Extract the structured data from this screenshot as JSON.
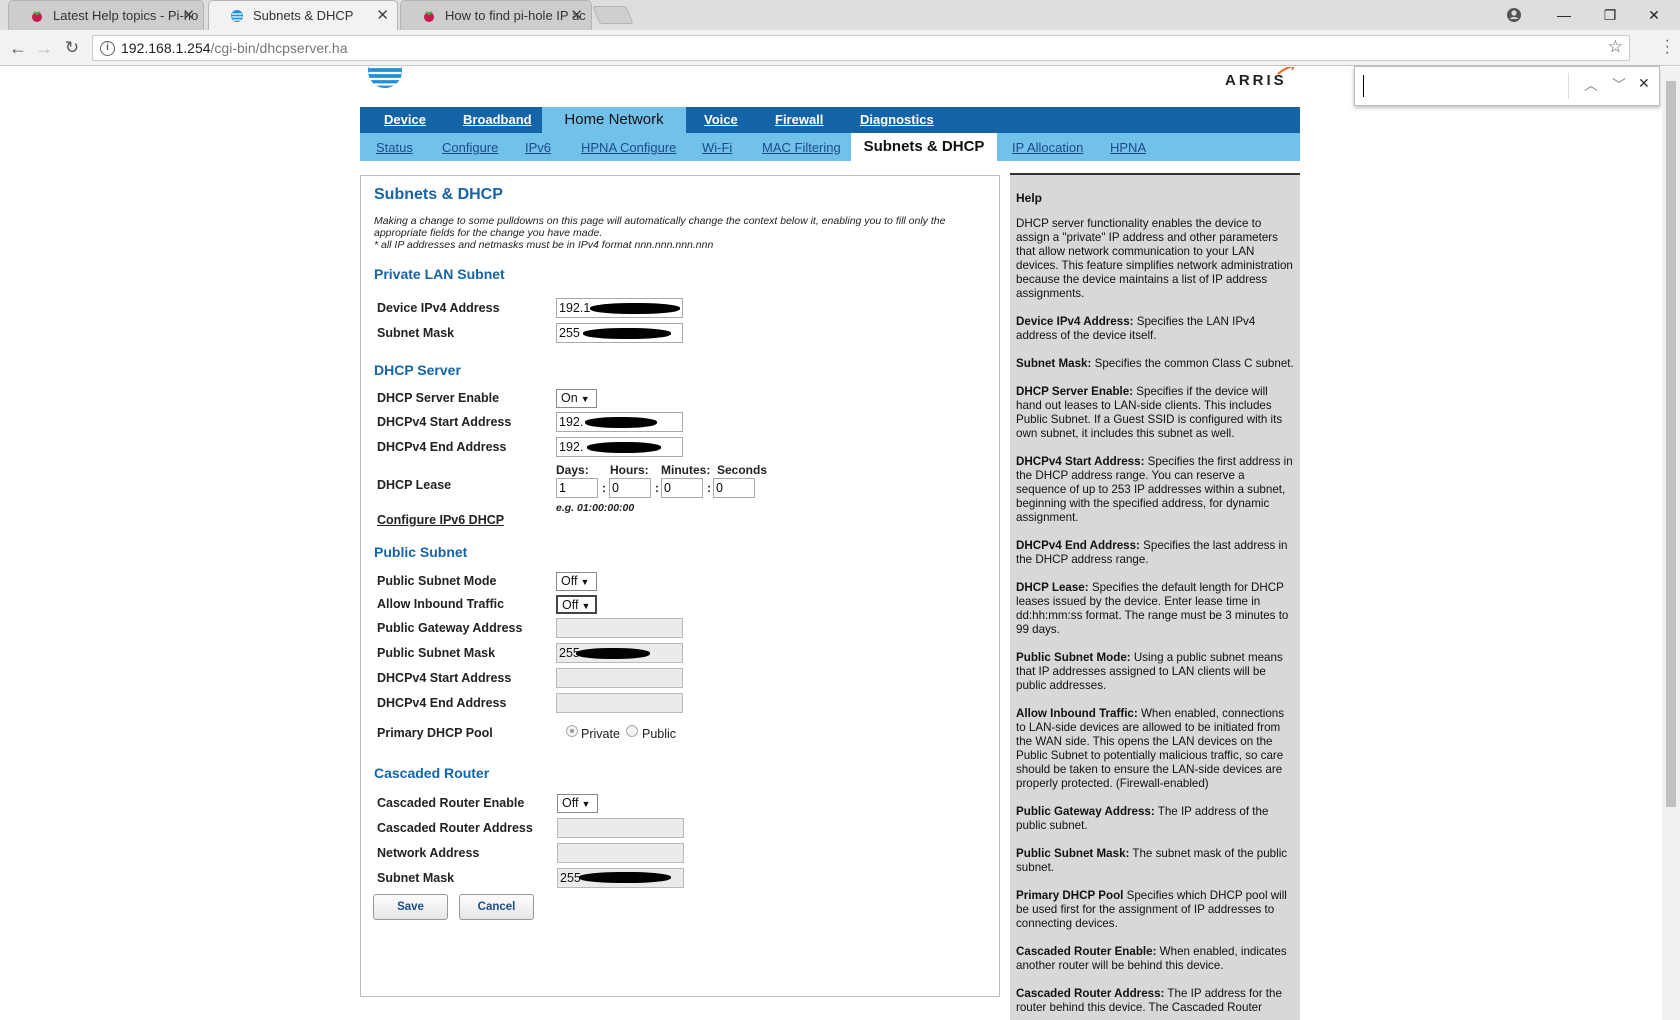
{
  "browser": {
    "tabs": [
      {
        "title": "Latest Help topics - Pi-ho",
        "active": false
      },
      {
        "title": "Subnets & DHCP",
        "active": true
      },
      {
        "title": "How to find pi-hole IP ac",
        "active": false
      }
    ],
    "url_host": "192.168.1.254",
    "url_path": "/cgi-bin/dhcpserver.ha"
  },
  "header": {
    "arris_logo": "ARRIS"
  },
  "mainnav": {
    "items": [
      "Device",
      "Broadband",
      "Home Network",
      "Voice",
      "Firewall",
      "Diagnostics"
    ],
    "active": "Home Network"
  },
  "subnav": {
    "items": [
      "Status",
      "Configure",
      "IPv6",
      "HPNA Configure",
      "Wi-Fi",
      "MAC Filtering",
      "Subnets & DHCP",
      "IP Allocation",
      "HPNA"
    ],
    "active": "Subnets & DHCP"
  },
  "main": {
    "title": "Subnets & DHCP",
    "intro1": "Making a change to some pulldowns on this page will automatically change the context below it, enabling you to fill only the appropriate fields for the change you have made.",
    "intro2": "* all IP addresses and netmasks must be in IPv4 format nnn.nnn.nnn.nnn",
    "private_lan": {
      "heading": "Private LAN Subnet",
      "device_ip_label": "Device IPv4 Address",
      "device_ip_value": "192.1",
      "subnet_mask_label": "Subnet Mask",
      "subnet_mask_value": "255"
    },
    "dhcp_server": {
      "heading": "DHCP Server",
      "enable_label": "DHCP Server Enable",
      "enable_value": "On",
      "start_label": "DHCPv4 Start Address",
      "start_value": "192.",
      "end_label": "DHCPv4 End Address",
      "end_value": "192.",
      "lease_label": "DHCP Lease",
      "lease_days_label": "Days:",
      "lease_hours_label": "Hours:",
      "lease_minutes_label": "Minutes:",
      "lease_seconds_label": "Seconds",
      "lease_days": "1",
      "lease_hours": "0",
      "lease_minutes": "0",
      "lease_seconds": "0",
      "lease_example": "e.g. 01:00:00:00",
      "ipv6_link": "Configure IPv6 DHCP"
    },
    "public_subnet": {
      "heading": "Public Subnet",
      "mode_label": "Public Subnet Mode",
      "mode_value": "Off",
      "inbound_label": "Allow Inbound Traffic",
      "inbound_value": "Off",
      "gateway_label": "Public Gateway Address",
      "mask_label": "Public Subnet Mask",
      "mask_value": "255",
      "start_label": "DHCPv4 Start Address",
      "end_label": "DHCPv4 End Address",
      "pool_label": "Primary DHCP Pool",
      "pool_private": "Private",
      "pool_public": "Public"
    },
    "cascaded": {
      "heading": "Cascaded Router",
      "enable_label": "Cascaded Router Enable",
      "enable_value": "Off",
      "address_label": "Cascaded Router Address",
      "network_label": "Network Address",
      "mask_label": "Subnet Mask",
      "mask_value": "255"
    },
    "save_label": "Save",
    "cancel_label": "Cancel"
  },
  "help": {
    "title": "Help",
    "intro": "DHCP server functionality enables the device to assign a \"private\" IP address and other parameters that allow network communication to your LAN devices. This feature simplifies network administration because the device maintains a list of IP address assignments.",
    "entries": [
      {
        "term": "Device IPv4 Address:",
        "desc": " Specifies the LAN IPv4 address of the device itself."
      },
      {
        "term": "Subnet Mask:",
        "desc": " Specifies the common Class C subnet."
      },
      {
        "term": "DHCP Server Enable:",
        "desc": " Specifies if the device will hand out leases to LAN-side clients. This includes Public Subnet. If a Guest SSID is configured with its own subnet, it includes this subnet as well."
      },
      {
        "term": "DHCPv4 Start Address:",
        "desc": " Specifies the first address in the DHCP address range. You can reserve a sequence of up to 253 IP addresses within a subnet, beginning with the specified address, for dynamic assignment."
      },
      {
        "term": "DHCPv4 End Address:",
        "desc": " Specifies the last address in the DHCP address range."
      },
      {
        "term": "DHCP Lease:",
        "desc": " Specifies the default length for DHCP leases issued by the device. Enter lease time in dd:hh:mm:ss format. The range must be 3 minutes to 99 days."
      },
      {
        "term": "Public Subnet Mode:",
        "desc": " Using a public subnet means that IP addresses assigned to LAN clients will be public addresses."
      },
      {
        "term": "Allow Inbound Traffic:",
        "desc": " When enabled, connections to LAN-side devices are allowed to be initiated from the WAN side. This opens the LAN devices on the Public Subnet to potentially malicious traffic, so care should be taken to ensure the LAN-side devices are properly protected. (Firewall-enabled)"
      },
      {
        "term": "Public Gateway Address:",
        "desc": " The IP address of the public subnet."
      },
      {
        "term": "Public Subnet Mask:",
        "desc": " The subnet mask of the public subnet."
      },
      {
        "term": "Primary DHCP Pool",
        "desc": " Specifies which DHCP pool will be used first for the assignment of IP addresses to connecting devices."
      },
      {
        "term": "Cascaded Router Enable:",
        "desc": " When enabled, indicates another router will be behind this device."
      },
      {
        "term": "Cascaded Router Address:",
        "desc": " The IP address for the router behind this device. The Cascaded Router"
      }
    ]
  }
}
